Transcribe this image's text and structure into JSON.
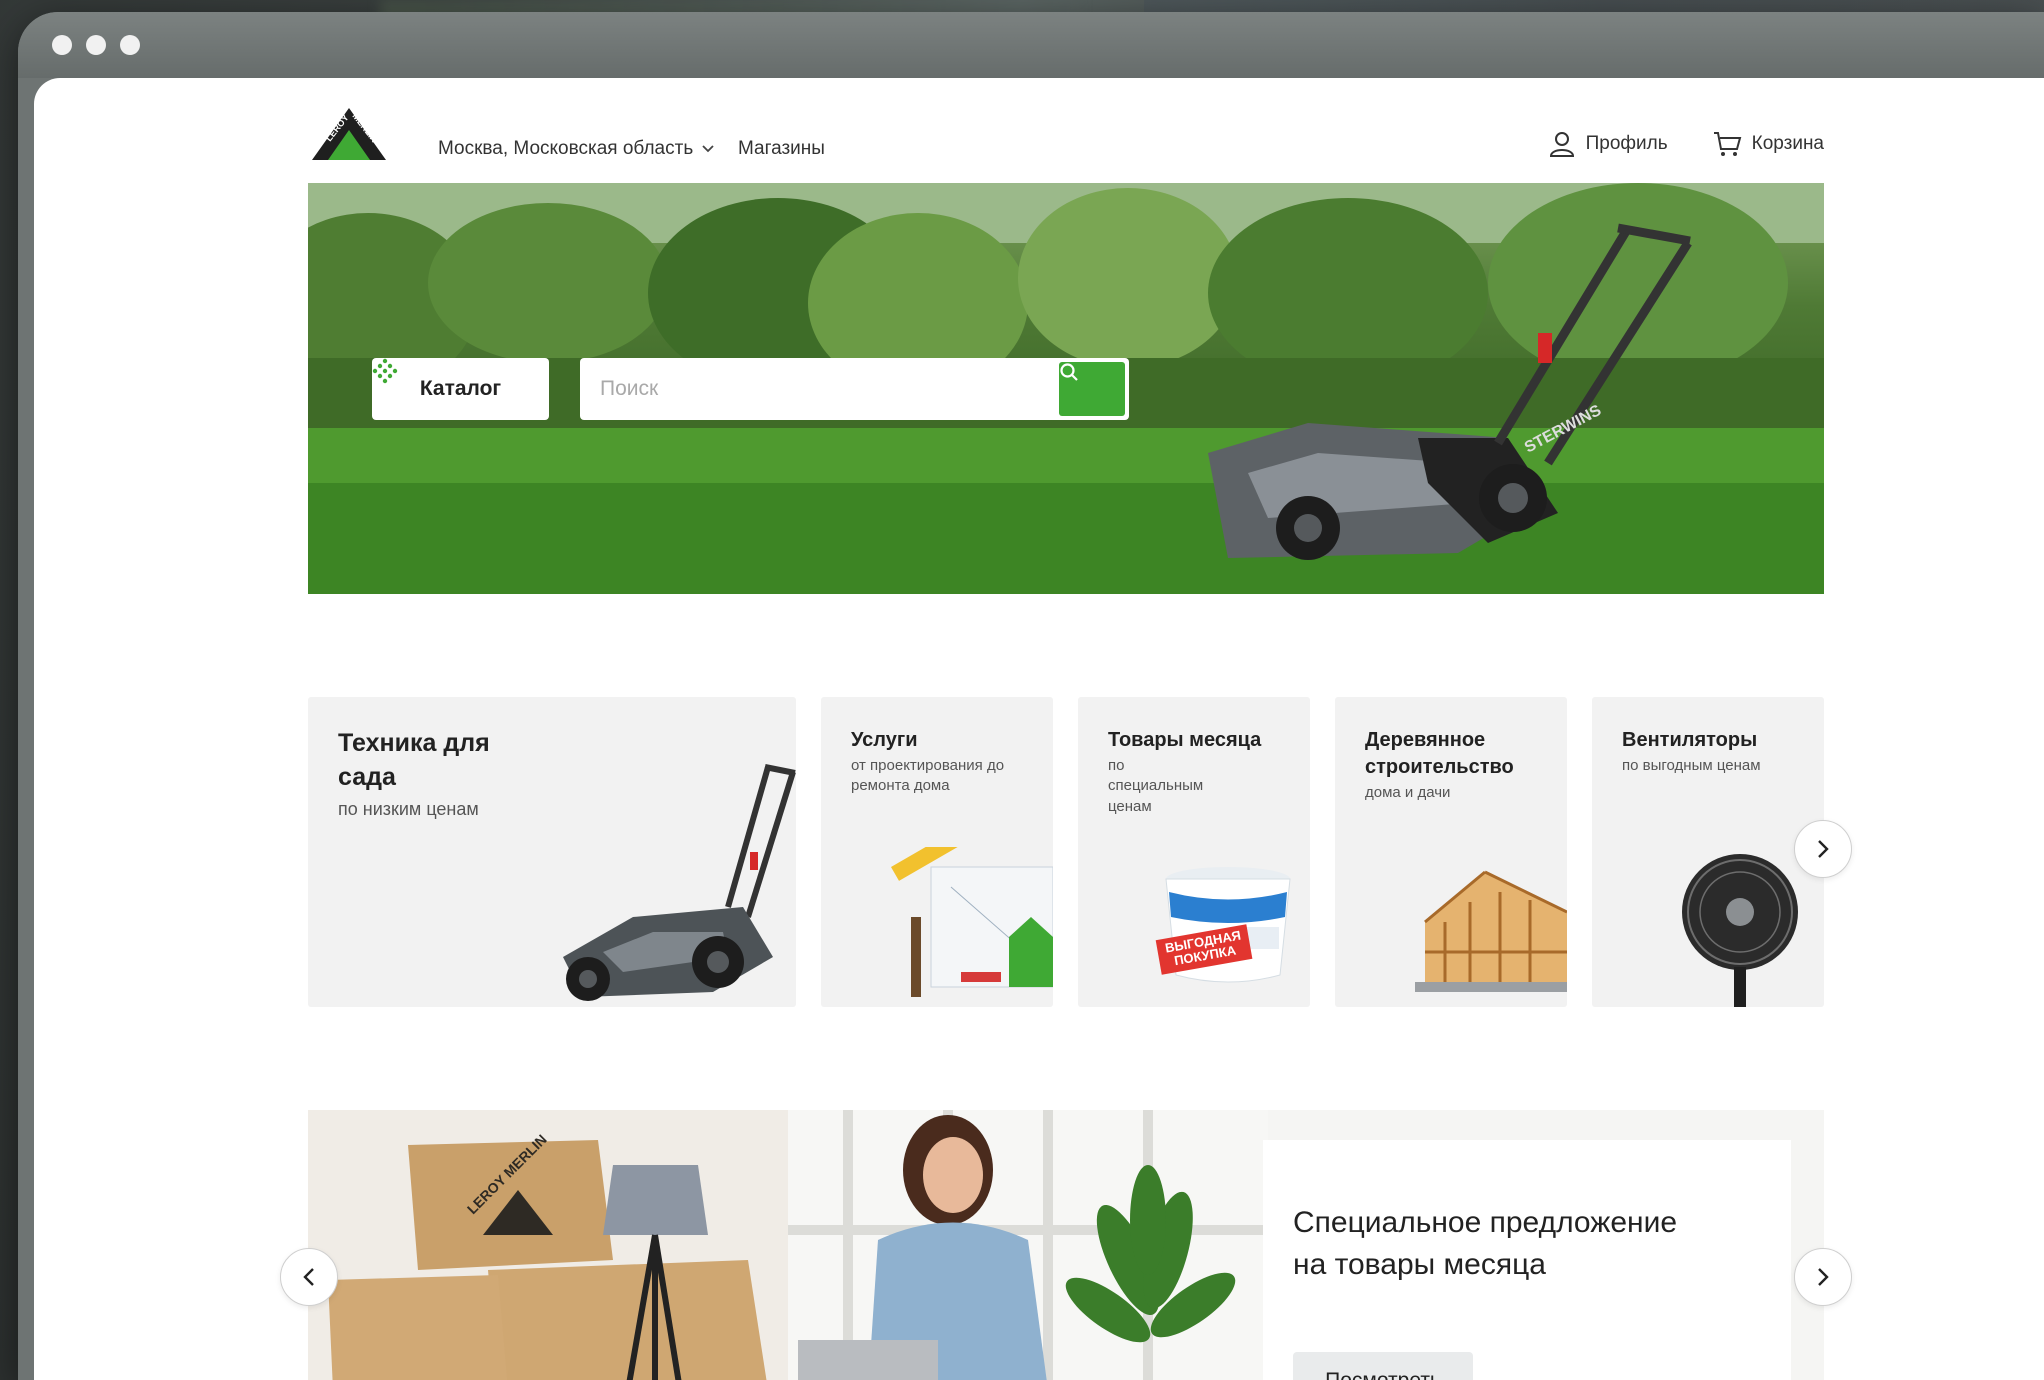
{
  "header": {
    "logo_text": "LEROY MERLIN",
    "region": "Москва, Московская область",
    "stores": "Магазины",
    "profile": "Профиль",
    "cart": "Корзина"
  },
  "hero": {
    "catalog_label": "Каталог",
    "search_placeholder": "Поиск",
    "product_brand": "STERWINS"
  },
  "cards": [
    {
      "title": "Техника для сада",
      "subtitle": "по низким ценам",
      "icon": "lawn-mower-icon"
    },
    {
      "title": "Услуги",
      "subtitle": "от проектирования до ремонта дома",
      "icon": "tools-icon"
    },
    {
      "title": "Товары месяца",
      "subtitle": "по специальным ценам",
      "badge": "ВЫГОДНАЯ ПОКУПКА",
      "icon": "paint-bucket-icon"
    },
    {
      "title": "Деревянное строительство",
      "subtitle": "дома и дачи",
      "icon": "wooden-house-icon"
    },
    {
      "title": "Вентиляторы",
      "subtitle": "по выгодным ценам",
      "icon": "fan-icon"
    }
  ],
  "promo": {
    "title": "Специальное предложение на товары месяца",
    "button": "Посмотреть",
    "box_logo": "LEROY MERLIN"
  },
  "colors": {
    "brand_green": "#3fa934",
    "card_bg": "#f2f2f2"
  }
}
